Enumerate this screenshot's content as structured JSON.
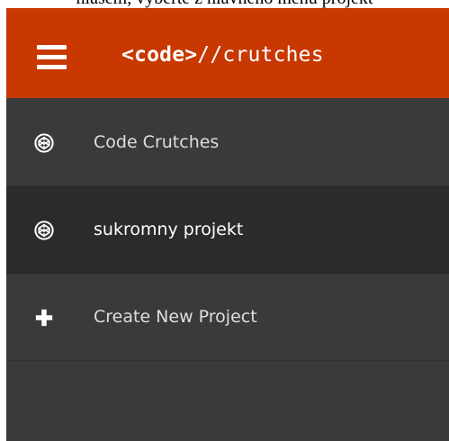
{
  "caption": {
    "text": "hlasem, vyberte z hlavného menu projekt"
  },
  "header": {
    "menu_icon": "hamburger-menu-icon",
    "logo_bold": "<code>",
    "logo_rest": "//crutches",
    "background_color": "#c83800"
  },
  "sidebar": {
    "background_color": "#3a3a3a",
    "active_background_color": "#2b2b2b",
    "items": [
      {
        "label": "Code Crutches",
        "icon": "codepen-icon",
        "active": false
      },
      {
        "label": "sukromny projekt",
        "icon": "codepen-icon",
        "active": true
      },
      {
        "label": "Create New Project",
        "icon": "plus-icon",
        "active": false
      }
    ]
  }
}
